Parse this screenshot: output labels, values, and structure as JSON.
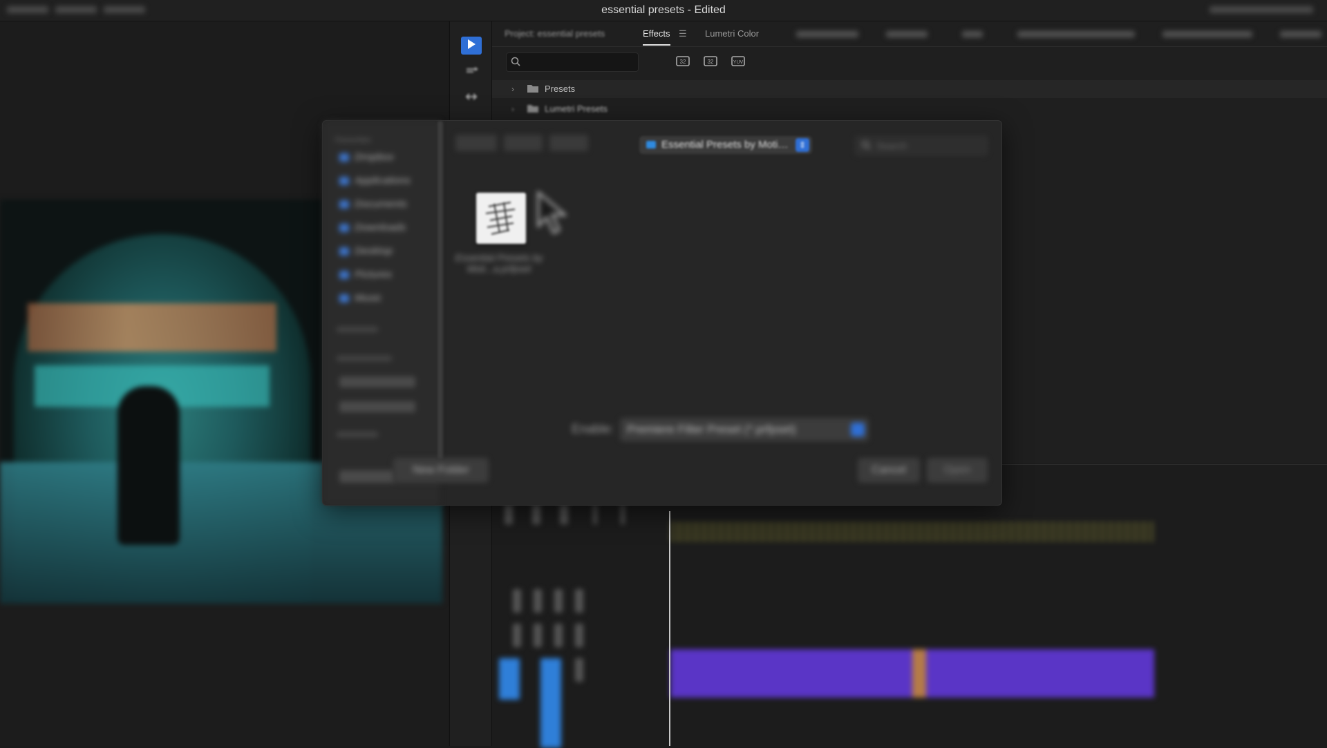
{
  "window": {
    "title": "essential presets - Edited"
  },
  "effects_panel": {
    "project_label": "Project: essential presets",
    "tabs": [
      "Effects",
      "Lumetri Color"
    ],
    "active_tab": "Effects",
    "search_placeholder": "",
    "tree": [
      {
        "label": "Presets"
      },
      {
        "label": "Lumetri Presets"
      }
    ]
  },
  "dialog": {
    "sidebar_heading": "Favourites",
    "sidebar_items": [
      "Dropbox",
      "Applications",
      "Documents",
      "Downloads",
      "Desktop",
      "Pictures",
      "Music"
    ],
    "location": "Essential Presets by Moti…",
    "search_placeholder": "Search",
    "file": {
      "name": "Essential Presets by Moti...a.prfpset",
      "icon": "preset-file-icon"
    },
    "enable_label": "Enable:",
    "enable_value": "Premiere Filter Preset (*.prfpset)",
    "buttons": {
      "new_folder": "New Folder",
      "cancel": "Cancel",
      "open": "Open"
    }
  },
  "colors": {
    "accent": "#2f6fd6",
    "clip": "#5a35c6",
    "background": "#1b1b1b"
  }
}
